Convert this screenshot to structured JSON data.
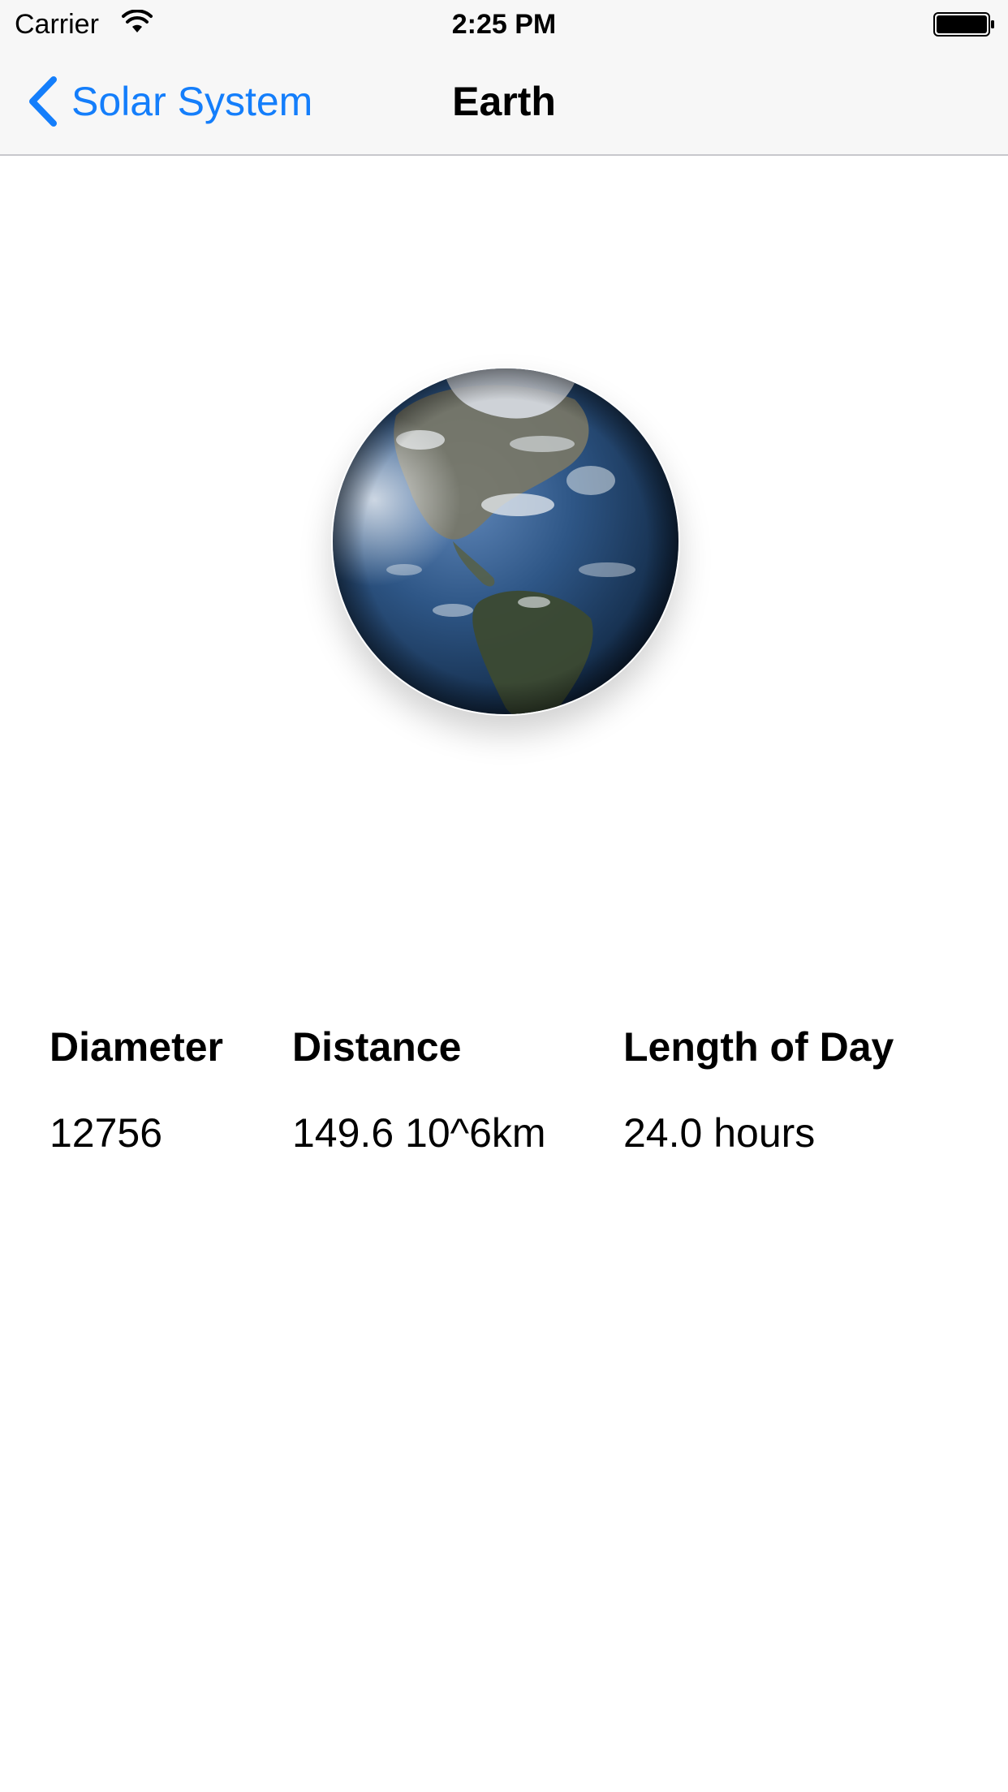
{
  "status_bar": {
    "carrier": "Carrier",
    "time": "2:25 PM",
    "wifi_icon": "wifi-icon",
    "battery_icon": "battery-full-icon"
  },
  "nav": {
    "back_label": "Solar System",
    "back_icon": "chevron-left-icon",
    "title": "Earth",
    "accent_color": "#147efb"
  },
  "planet": {
    "name": "Earth",
    "image_kind": "planet-globe-image"
  },
  "stats": {
    "diameter": {
      "label": "Diameter",
      "value": "12756"
    },
    "distance": {
      "label": "Distance",
      "value": "149.6 10^6km"
    },
    "day_length": {
      "label": "Length of Day",
      "value": "24.0 hours"
    }
  }
}
